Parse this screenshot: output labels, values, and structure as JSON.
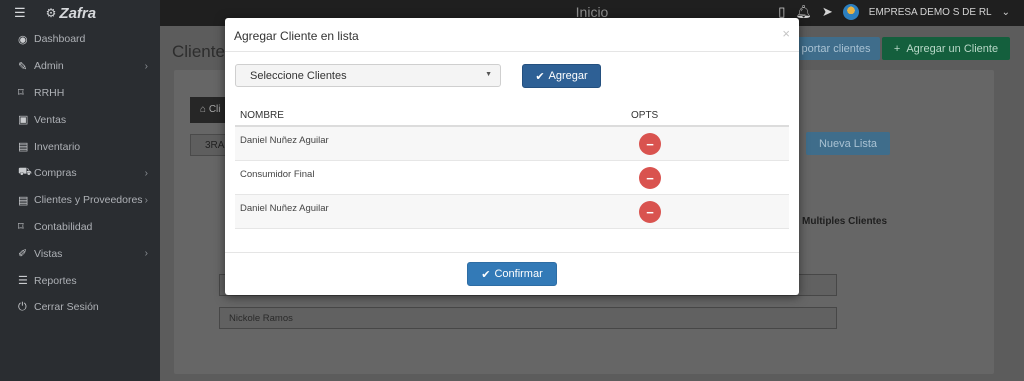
{
  "app": {
    "brand": "Zafra",
    "page_title": "Inicio",
    "company": "EMPRESA DEMO S DE RL"
  },
  "topbar": {
    "icons": [
      "mobile-icon",
      "bell-icon",
      "paper-plane-icon",
      "avatar"
    ]
  },
  "sidebar": {
    "items": [
      {
        "label": "Dashboard",
        "icon": "dashboard-icon",
        "has_children": false
      },
      {
        "label": "Admin",
        "icon": "wrench-icon",
        "has_children": true
      },
      {
        "label": "RRHH",
        "icon": "tag-icon",
        "has_children": false
      },
      {
        "label": "Ventas",
        "icon": "money-icon",
        "has_children": false
      },
      {
        "label": "Inventario",
        "icon": "book-icon",
        "has_children": false
      },
      {
        "label": "Compras",
        "icon": "cart-icon",
        "has_children": true
      },
      {
        "label": "Clientes y Proveedores",
        "icon": "book-icon",
        "has_children": true
      },
      {
        "label": "Contabilidad",
        "icon": "tag-icon",
        "has_children": false
      },
      {
        "label": "Vistas",
        "icon": "edit-icon",
        "has_children": true
      },
      {
        "label": "Reportes",
        "icon": "list-icon",
        "has_children": false
      },
      {
        "label": "Cerrar Sesión",
        "icon": "power-icon",
        "has_children": false
      }
    ]
  },
  "background": {
    "page_heading": "Clientes",
    "export_button": "portar clientes",
    "add_client_button": "Agregar un Cliente",
    "tab_label": "Cli",
    "combo_value": "3RA",
    "new_list_button": "Nueva Lista",
    "multi_label": "Multiples Clientes",
    "field_value": "Nickole Ramos"
  },
  "modal": {
    "title": "Agregar Cliente en lista",
    "close": "×",
    "select_placeholder": "Seleccione Clientes",
    "add_button": "Agregar",
    "columns": {
      "name": "NOMBRE",
      "opts": "OPTS"
    },
    "rows": [
      {
        "name": "Daniel Nuñez Aguilar"
      },
      {
        "name": "Consumidor Final"
      },
      {
        "name": "Daniel Nuñez Aguilar"
      }
    ],
    "confirm_button": "Confirmar"
  }
}
